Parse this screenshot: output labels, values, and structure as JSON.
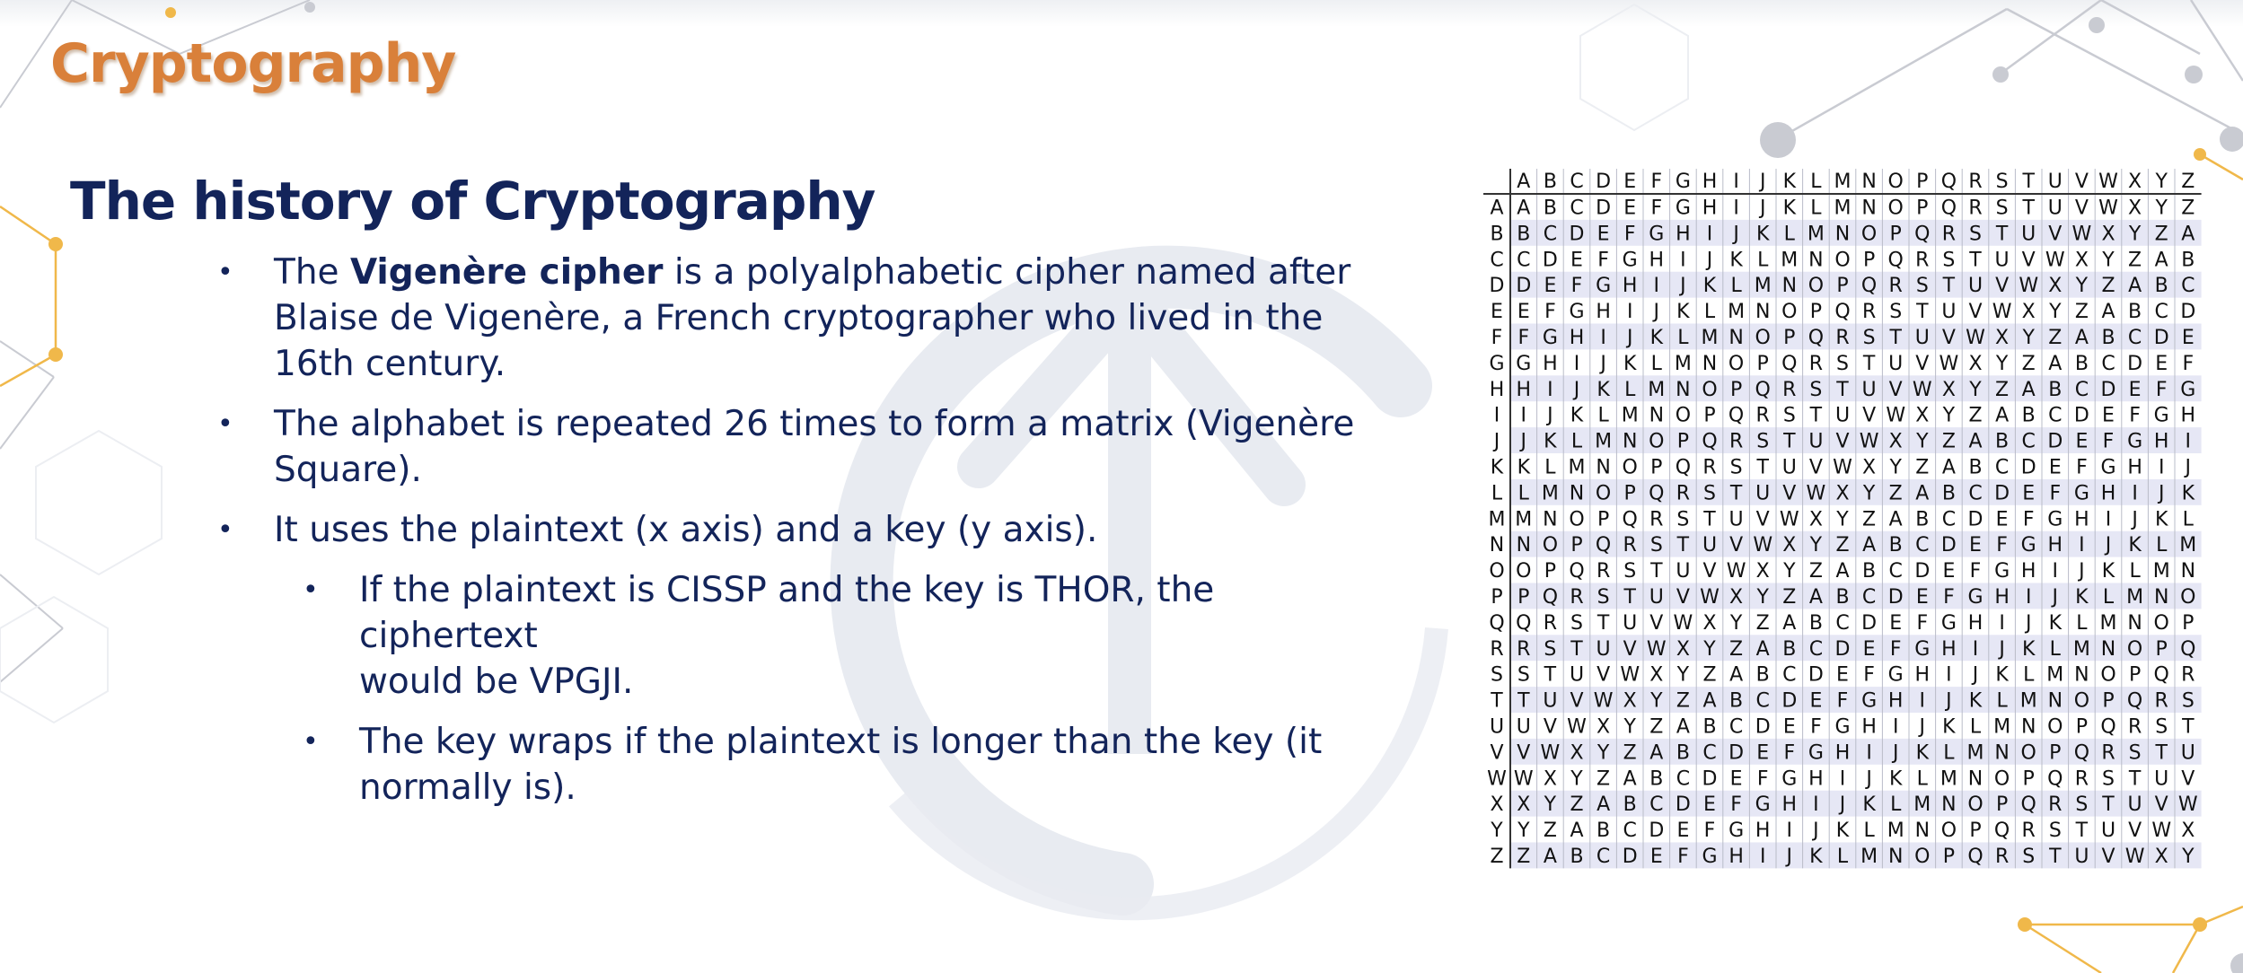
{
  "slide": {
    "brand_title": "Cryptography",
    "heading": "The history of Cryptography",
    "bullets": [
      {
        "pre": "The ",
        "bold": "Vigenère cipher",
        "line1_rest": " is a polyalphabetic cipher named after",
        "line2": "Blaise de Vigenère, a French cryptographer who lived in the",
        "line3": "16th century."
      },
      {
        "line1": "The alphabet is repeated 26 times to form a matrix (Vigenère",
        "line2": "Square)."
      },
      {
        "line1": "It uses the plaintext (x axis) and a key (y axis)."
      }
    ],
    "sub_bullets": [
      {
        "line1": "If the plaintext is CISSP and the key is THOR, the ciphertext",
        "line2": "would be VPGJI."
      },
      {
        "line1": "The key wraps if the plaintext is longer than the key (it",
        "line2": "normally is)."
      }
    ],
    "bullet_glyph": "•"
  },
  "vigenere_square": {
    "alphabet": "ABCDEFGHIJKLMNOPQRSTUVWXYZ",
    "colors": {
      "grid_line": "#b9bcc8",
      "header_rule": "#333333",
      "stripe": "#e6e7f5",
      "text": "#111111"
    }
  },
  "theme": {
    "brand_color": "#d9803a",
    "text_color": "#13245a",
    "watermark_color": "#e8ebf1",
    "accent_gold": "#f0b84a",
    "network_gray": "#c9cbd2"
  }
}
